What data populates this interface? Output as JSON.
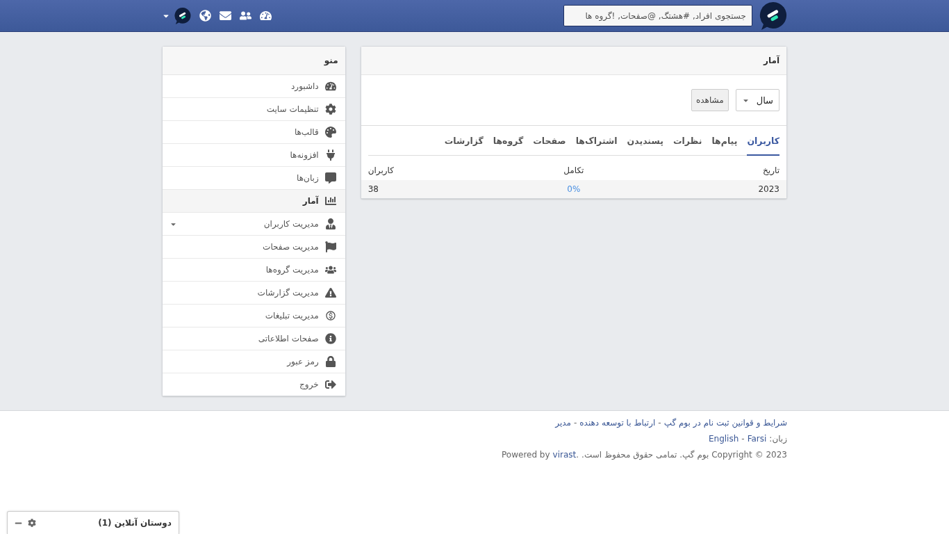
{
  "header": {
    "search": {
      "placeholder": "جستجوی افراد, #هشتگ, @صفحات, !گروه ها"
    }
  },
  "stats": {
    "title": "آمار",
    "period_select": {
      "value": "سال"
    },
    "view_button": "مشاهده",
    "tabs": [
      {
        "label": "کاربران",
        "selected": true
      },
      {
        "label": "پیام‌ها",
        "selected": false
      },
      {
        "label": "نظرات",
        "selected": false
      },
      {
        "label": "پسندیدن",
        "selected": false
      },
      {
        "label": "اشتراک‌ها",
        "selected": false
      },
      {
        "label": "صفحات",
        "selected": false
      },
      {
        "label": "گروه‌ها",
        "selected": false
      },
      {
        "label": "گزارشات",
        "selected": false
      }
    ],
    "table": {
      "columns": [
        "تاریخ",
        "تکامل",
        "کاربران"
      ],
      "rows": [
        {
          "date": "2023",
          "growth": "0%",
          "users": "38"
        }
      ]
    }
  },
  "menu": {
    "title": "منو",
    "items": [
      {
        "label": "داشبورد",
        "selected": false,
        "has_submenu": false
      },
      {
        "label": "تنظیمات سایت",
        "selected": false,
        "has_submenu": false
      },
      {
        "label": "قالب‌ها",
        "selected": false,
        "has_submenu": false
      },
      {
        "label": "افزونه‌ها",
        "selected": false,
        "has_submenu": false
      },
      {
        "label": "زبان‌ها",
        "selected": false,
        "has_submenu": false
      },
      {
        "label": "آمار",
        "selected": true,
        "has_submenu": false
      },
      {
        "label": "مدیریت کاربران",
        "selected": false,
        "has_submenu": true
      },
      {
        "label": "مدیریت صفحات",
        "selected": false,
        "has_submenu": false
      },
      {
        "label": "مدیریت گروه‌ها",
        "selected": false,
        "has_submenu": false
      },
      {
        "label": "مدیریت گزارشات",
        "selected": false,
        "has_submenu": false
      },
      {
        "label": "مدیریت تبلیغات",
        "selected": false,
        "has_submenu": false
      },
      {
        "label": "صفحات اطلاعاتی",
        "selected": false,
        "has_submenu": false
      },
      {
        "label": "رمز عبور",
        "selected": false,
        "has_submenu": false
      },
      {
        "label": "خروج",
        "selected": false,
        "has_submenu": false
      }
    ]
  },
  "footer": {
    "links": [
      "شرایط و قوانین ثبت نام در بوم گپ",
      "ارتباط با توسعه دهنده",
      "مدیر"
    ],
    "separator": "-",
    "language_label": "زبان:",
    "languages": [
      "Farsi",
      "English"
    ],
    "copyright": "2023 © Copyright بوم گپ. تمامی حقوق محفوظ است.",
    "powered_by": "Powered by",
    "powered_link": "virast",
    "end": "."
  },
  "chat": {
    "title": "دوستان آنلاین (1)"
  }
}
